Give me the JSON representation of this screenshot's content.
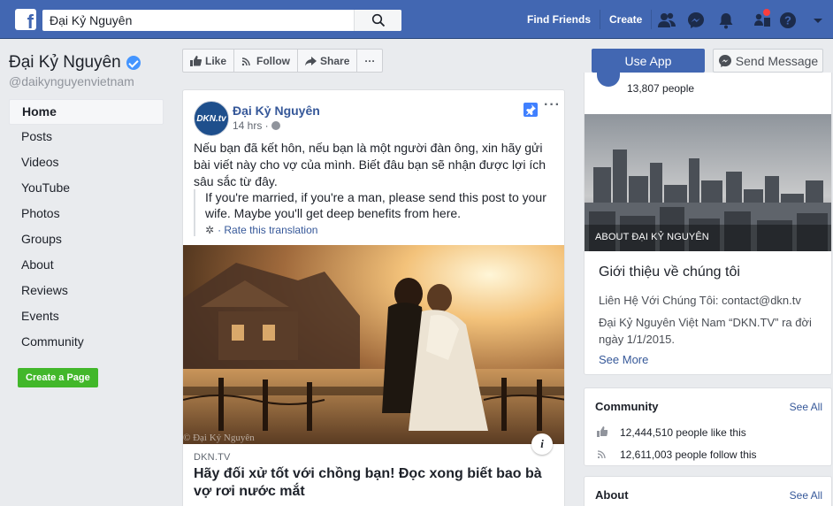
{
  "topbar": {
    "search_value": "Đại Kỷ Nguyên",
    "links": [
      "Find Friends",
      "Create"
    ]
  },
  "page": {
    "name": "Đại Kỷ Nguyên",
    "handle": "@daikynguyenvietnam"
  },
  "nav": {
    "items": [
      "Home",
      "Posts",
      "Videos",
      "YouTube",
      "Photos",
      "Groups",
      "About",
      "Reviews",
      "Events",
      "Community"
    ],
    "active": "Home",
    "create_page": "Create a Page"
  },
  "actions": {
    "like": "Like",
    "follow": "Follow",
    "share": "Share",
    "more": "···",
    "use_app": "Use App",
    "send_message": "Send Message"
  },
  "post": {
    "avatar_text": "DKN.tv",
    "author": "Đại Kỷ Nguyên",
    "time": "14 hrs ·",
    "more": "···",
    "text": "Nếu bạn đã kết hôn, nếu bạn là một người đàn ông, xin hãy gửi bài viết này cho vợ của mình. Biết đâu bạn sẽ nhận được lợi ích sâu sắc từ đây.",
    "translation": "If you're married, if you're a man, please send this post to your wife. Maybe you'll get deep benefits from here.",
    "rate_translation": "· Rate this translation",
    "watermark": "© Đại Kỷ Nguyên",
    "info": "i",
    "link_domain": "DKN.TV",
    "link_title": "Hãy đối xử tốt với chồng bạn! Đọc xong biết bao bà vợ rơi nước mắt"
  },
  "sidebar": {
    "people_count": "13,807 people",
    "about_overlay": "ABOUT ĐẠI KỶ NGUYÊN",
    "intro_title": "Giới thiệu về chúng tôi",
    "contact": "Liên Hệ Với Chúng Tôi: contact@dkn.tv",
    "desc": "Đại Kỷ Nguyên Việt Nam “DKN.TV” ra đời ngày 1/1/2015.",
    "see_more": "See More",
    "community_title": "Community",
    "see_all": "See All",
    "likes": "12,444,510 people like this",
    "follows": "12,611,003 people follow this",
    "about_title": "About"
  },
  "colors": {
    "brand": "#4267b2",
    "link": "#365899",
    "green": "#42b72a"
  }
}
